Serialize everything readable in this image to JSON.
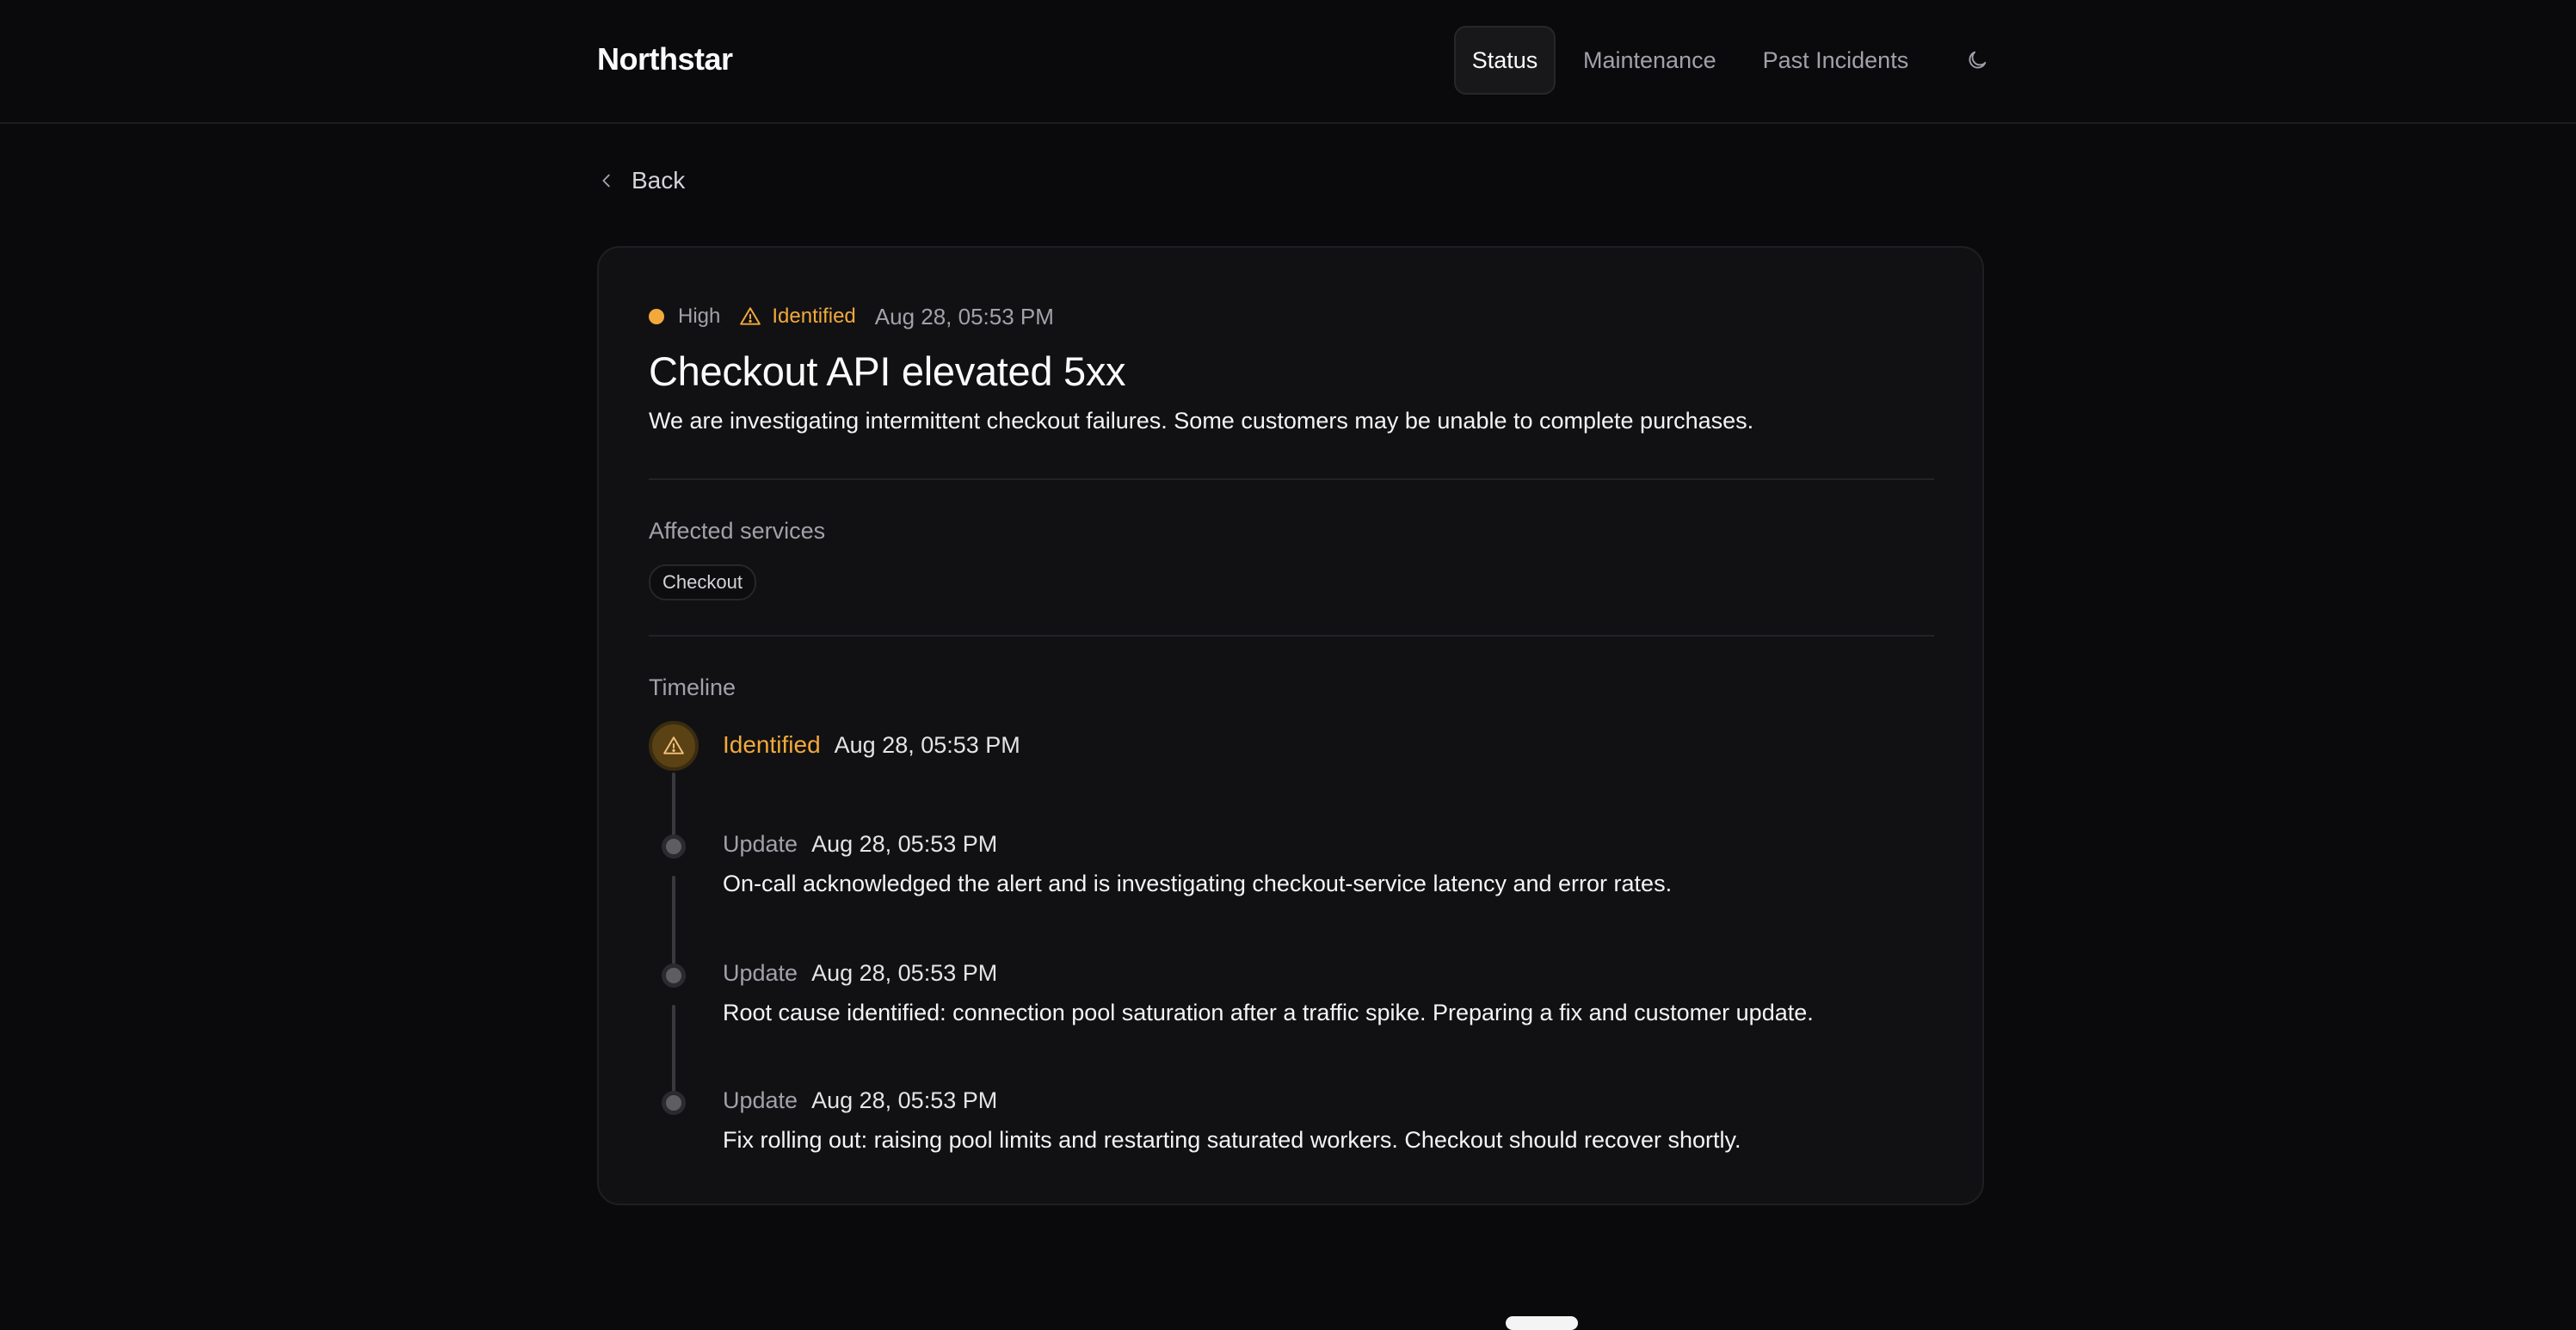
{
  "header": {
    "brand": "Northstar",
    "nav": [
      {
        "label": "Status"
      },
      {
        "label": "Maintenance"
      },
      {
        "label": "Past Incidents"
      }
    ],
    "theme_icon": "moon-icon"
  },
  "back": {
    "label": "Back",
    "icon": "chevron-left-icon"
  },
  "incident": {
    "severity": "High",
    "status": "Identified",
    "date": "Aug 28, 05:53 PM",
    "title": "Checkout API elevated 5xx",
    "description": "We are investigating intermittent checkout failures. Some customers may be unable to complete purchases.",
    "colors": {
      "accent": "#f2a93b"
    }
  },
  "affected": {
    "label": "Affected services",
    "services": [
      "Checkout"
    ]
  },
  "timeline": {
    "label": "Timeline",
    "entries": [
      {
        "kind": "Identified",
        "date": "Aug 28, 05:53 PM",
        "text": ""
      },
      {
        "kind": "Update",
        "date": "Aug 28, 05:53 PM",
        "text": "On-call acknowledged the alert and is investigating checkout-service latency and error rates."
      },
      {
        "kind": "Update",
        "date": "Aug 28, 05:53 PM",
        "text": "Root cause identified: connection pool saturation after a traffic spike. Preparing a fix and customer update."
      },
      {
        "kind": "Update",
        "date": "Aug 28, 05:53 PM",
        "text": "Fix rolling out: raising pool limits and restarting saturated workers. Checkout should recover shortly."
      }
    ]
  }
}
